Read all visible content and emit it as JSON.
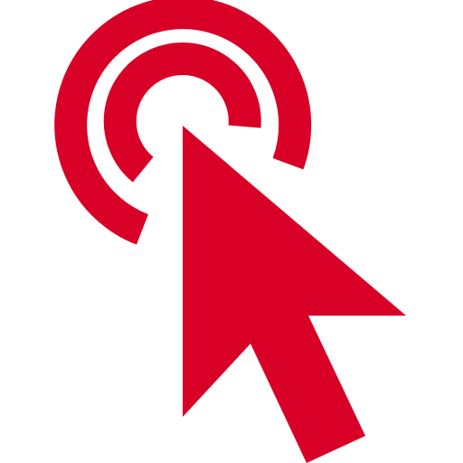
{
  "icon": {
    "name": "click-cursor-icon",
    "color": "#D80027",
    "background": "#FFFFFF"
  }
}
